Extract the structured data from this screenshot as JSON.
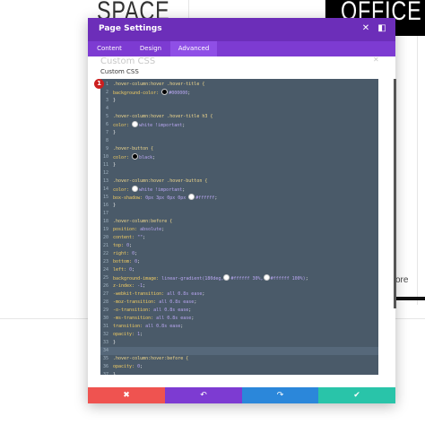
{
  "background": {
    "word_left": "SPACE",
    "word_right": "OFFICE",
    "fragment": "ore"
  },
  "modal": {
    "title": "Page Settings",
    "close_icon": "✕",
    "expand_icon": "◧",
    "tabs": [
      {
        "label": "Content"
      },
      {
        "label": "Design"
      },
      {
        "label": "Advanced"
      }
    ],
    "active_tab": "Advanced",
    "section_ghost": "Custom CSS",
    "section_ghost_x": "✕",
    "section_label": "Custom CSS",
    "error_count": "1",
    "footer": {
      "cancel_icon": "✖",
      "undo_icon": "↶",
      "redo_icon": "↷",
      "save_icon": "✔"
    },
    "colors": {
      "header": "#6c2eb9",
      "tabbar": "#7d3bd2",
      "editor_bg": "#4a5a69",
      "cancel": "#ef5350",
      "undo": "#7d3bd2",
      "redo": "#2b87da",
      "save": "#29c4a9"
    }
  },
  "css_lines": [
    {
      "n": "1",
      "parts": [
        [
          "sel",
          ".hover-column:hover .hover-title {"
        ]
      ]
    },
    {
      "n": "2",
      "parts": [
        [
          "prop",
          "background-color: "
        ],
        [
          "sw",
          "#000000"
        ],
        [
          "val",
          "#000000"
        ],
        [
          "pun",
          ";"
        ]
      ]
    },
    {
      "n": "3",
      "parts": [
        [
          "pun",
          "}"
        ]
      ]
    },
    {
      "n": "4",
      "parts": []
    },
    {
      "n": "5",
      "parts": [
        [
          "sel",
          ".hover-column:hover .hover-title h3 {"
        ]
      ]
    },
    {
      "n": "6",
      "parts": [
        [
          "prop",
          "color: "
        ],
        [
          "sw",
          "#ffffff"
        ],
        [
          "val",
          "white !important"
        ],
        [
          "pun",
          ";"
        ]
      ]
    },
    {
      "n": "7",
      "parts": [
        [
          "pun",
          "}"
        ]
      ]
    },
    {
      "n": "8",
      "parts": []
    },
    {
      "n": "9",
      "parts": [
        [
          "sel",
          ".hover-button {"
        ]
      ]
    },
    {
      "n": "10",
      "parts": [
        [
          "prop",
          "color: "
        ],
        [
          "sw",
          "#000000"
        ],
        [
          "val",
          "black"
        ],
        [
          "pun",
          ";"
        ]
      ]
    },
    {
      "n": "11",
      "parts": [
        [
          "pun",
          "}"
        ]
      ]
    },
    {
      "n": "12",
      "parts": []
    },
    {
      "n": "13",
      "parts": [
        [
          "sel",
          ".hover-column:hover .hover-button {"
        ]
      ]
    },
    {
      "n": "14",
      "parts": [
        [
          "prop",
          "color: "
        ],
        [
          "sw",
          "#ffffff"
        ],
        [
          "val",
          "white !important"
        ],
        [
          "pun",
          ";"
        ]
      ]
    },
    {
      "n": "15",
      "parts": [
        [
          "prop",
          "box-shadow: "
        ],
        [
          "val",
          "0px 3px 0px 0px "
        ],
        [
          "sw",
          "#ffffff"
        ],
        [
          "val",
          "#ffffff"
        ],
        [
          "pun",
          ";"
        ]
      ]
    },
    {
      "n": "16",
      "parts": [
        [
          "pun",
          "}"
        ]
      ]
    },
    {
      "n": "17",
      "parts": []
    },
    {
      "n": "18",
      "parts": [
        [
          "sel",
          ".hover-column:before {"
        ]
      ]
    },
    {
      "n": "19",
      "parts": [
        [
          "prop",
          "position: "
        ],
        [
          "val",
          "absolute"
        ],
        [
          "pun",
          ";"
        ]
      ]
    },
    {
      "n": "20",
      "parts": [
        [
          "prop",
          "content: "
        ],
        [
          "val",
          "\"\""
        ],
        [
          "pun",
          ";"
        ]
      ]
    },
    {
      "n": "21",
      "parts": [
        [
          "prop",
          "top: "
        ],
        [
          "val",
          "0"
        ],
        [
          "pun",
          ";"
        ]
      ]
    },
    {
      "n": "22",
      "parts": [
        [
          "prop",
          "right: "
        ],
        [
          "val",
          "0"
        ],
        [
          "pun",
          ";"
        ]
      ]
    },
    {
      "n": "23",
      "parts": [
        [
          "prop",
          "bottom: "
        ],
        [
          "val",
          "0"
        ],
        [
          "pun",
          ";"
        ]
      ]
    },
    {
      "n": "24",
      "parts": [
        [
          "prop",
          "left: "
        ],
        [
          "val",
          "0"
        ],
        [
          "pun",
          ";"
        ]
      ]
    },
    {
      "n": "25",
      "parts": [
        [
          "prop",
          "background-image: "
        ],
        [
          "val",
          "linear-gradient(180deg,"
        ],
        [
          "sw",
          "#ffffff"
        ],
        [
          "val",
          "#ffffff 30%,"
        ],
        [
          "sw",
          "#ffffff"
        ],
        [
          "val",
          "#ffffff 100%)"
        ],
        [
          "pun",
          ";"
        ]
      ]
    },
    {
      "n": "26",
      "parts": [
        [
          "prop",
          "z-index: "
        ],
        [
          "val",
          "-1"
        ],
        [
          "pun",
          ";"
        ]
      ]
    },
    {
      "n": "27",
      "parts": [
        [
          "prop",
          "-webkit-transition: "
        ],
        [
          "val",
          "all 0.8s ease"
        ],
        [
          "pun",
          ";"
        ]
      ]
    },
    {
      "n": "28",
      "parts": [
        [
          "prop",
          "-moz-transition: "
        ],
        [
          "val",
          "all 0.8s ease"
        ],
        [
          "pun",
          ";"
        ]
      ]
    },
    {
      "n": "29",
      "parts": [
        [
          "prop",
          "-o-transition: "
        ],
        [
          "val",
          "all 0.8s ease"
        ],
        [
          "pun",
          ";"
        ]
      ]
    },
    {
      "n": "30",
      "parts": [
        [
          "prop",
          "-ms-transition: "
        ],
        [
          "val",
          "all 0.8s ease"
        ],
        [
          "pun",
          ";"
        ]
      ]
    },
    {
      "n": "31",
      "parts": [
        [
          "prop",
          "transition: "
        ],
        [
          "val",
          "all 0.8s ease"
        ],
        [
          "pun",
          ";"
        ]
      ]
    },
    {
      "n": "32",
      "parts": [
        [
          "prop",
          "opacity: "
        ],
        [
          "val",
          "1"
        ],
        [
          "pun",
          ";"
        ]
      ]
    },
    {
      "n": "33",
      "parts": [
        [
          "pun",
          "}"
        ]
      ]
    },
    {
      "n": "34",
      "parts": [],
      "highlight": true
    },
    {
      "n": "35",
      "parts": [
        [
          "sel",
          ".hover-column:hover:before {"
        ]
      ]
    },
    {
      "n": "36",
      "parts": [
        [
          "prop",
          "opacity: "
        ],
        [
          "val",
          "0"
        ],
        [
          "pun",
          ";"
        ]
      ]
    },
    {
      "n": "37",
      "parts": [
        [
          "pun",
          "}"
        ]
      ]
    }
  ]
}
